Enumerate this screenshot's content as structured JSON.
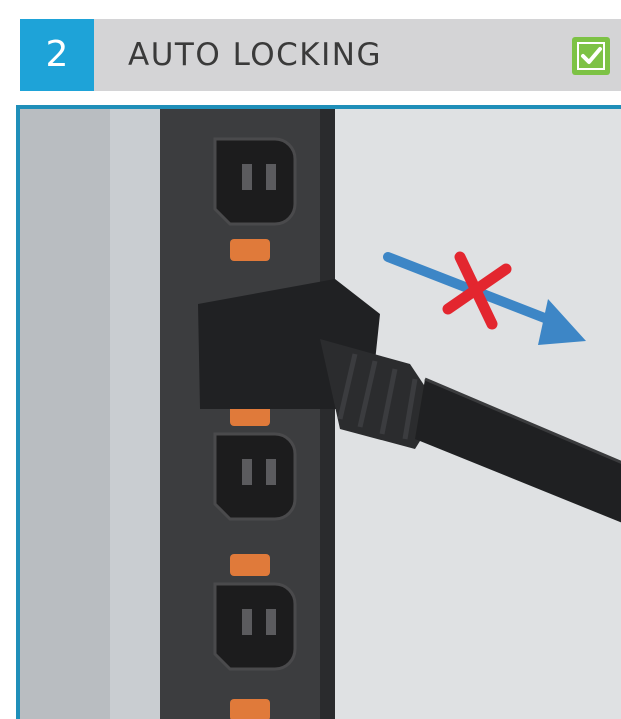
{
  "step": {
    "number": "2",
    "title": "AUTO LOCKING"
  },
  "icons": {
    "status": "check-icon",
    "pull_arrow": "arrow-right-icon",
    "blocked": "cross-icon"
  },
  "colors": {
    "number_box": "#1ea3d8",
    "header_bg": "#d4d4d6",
    "check_bg": "#7dc245",
    "arrow": "#3d86c6",
    "cross": "#e3262f",
    "lock_tab": "#e07a3a"
  }
}
